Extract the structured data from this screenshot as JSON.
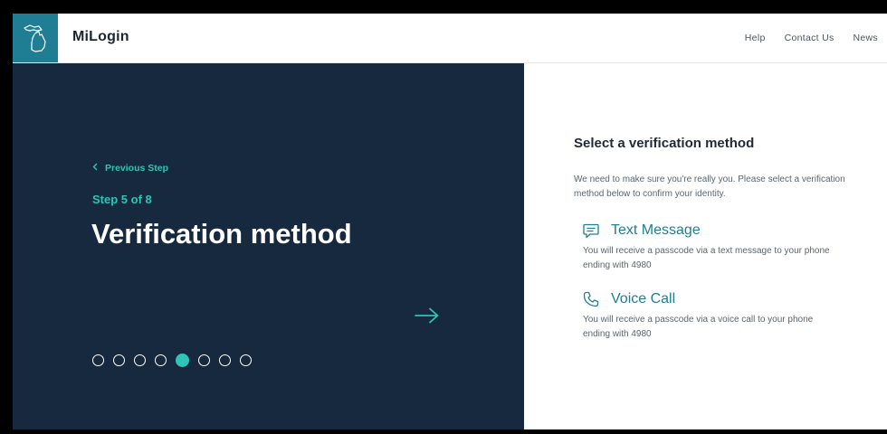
{
  "header": {
    "app_name": "MiLogin",
    "logo_icon": "michigan-map-icon",
    "nav": [
      "Help",
      "Contact Us",
      "News"
    ]
  },
  "left_panel": {
    "previous_step_label": "Previous Step",
    "step_label": "Step 5 of 8",
    "heading": "Verification method",
    "step_dots": {
      "total": 8,
      "current": 5
    },
    "next_icon": "arrow-right-icon"
  },
  "right_panel": {
    "title": "Select a verification method",
    "description": "We need to make sure you're really you. Please select a verification method below to confirm your identity.",
    "options": [
      {
        "icon": "chat-bubble-icon",
        "title": "Text Message",
        "description": "You will receive a passcode via a text message to your phone ending with 4980"
      },
      {
        "icon": "phone-icon",
        "title": "Voice Call",
        "description": "You will receive a passcode via a voice call to your phone ending with 4980"
      }
    ]
  },
  "colors": {
    "brand_teal": "#1f7e93",
    "accent_teal": "#2ec4b6",
    "panel_navy": "#17293e"
  }
}
